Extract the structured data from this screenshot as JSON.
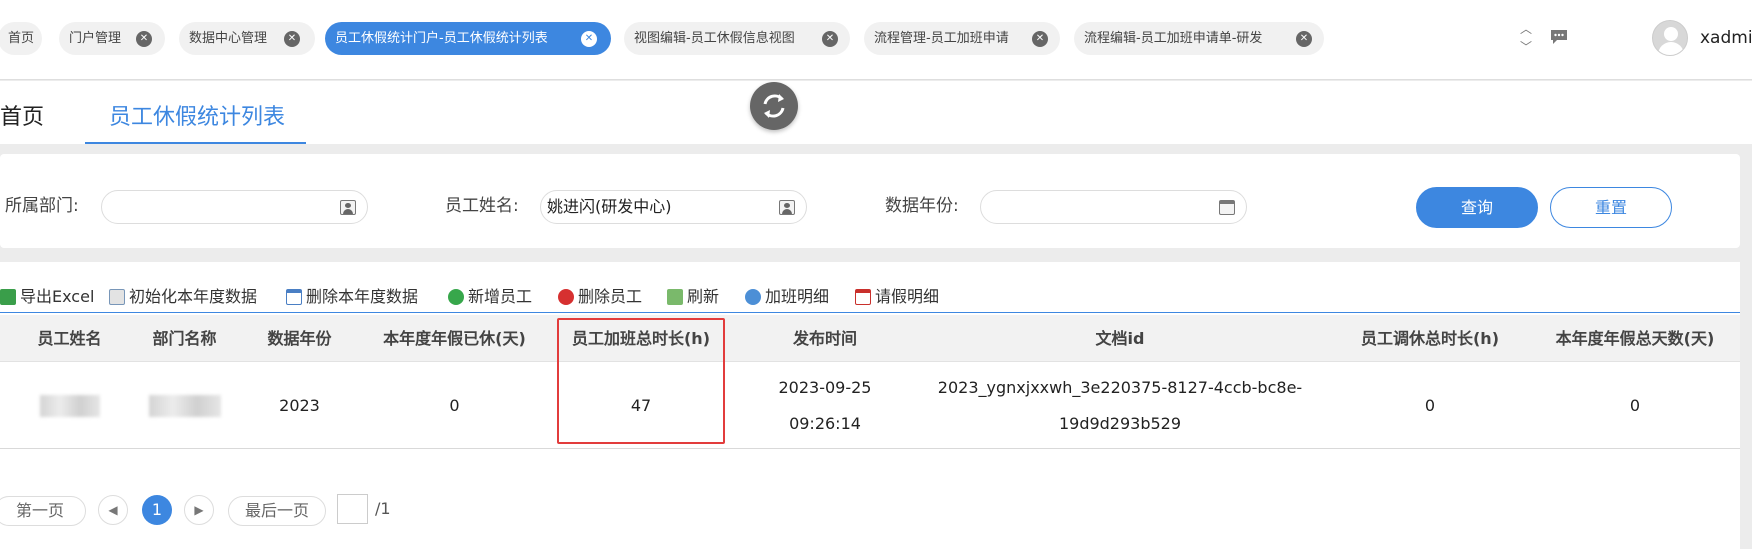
{
  "top_tabs": [
    {
      "label": "首页",
      "closable": false
    },
    {
      "label": "门户管理",
      "closable": true
    },
    {
      "label": "数据中心管理",
      "closable": true
    },
    {
      "label": "员工休假统计门户-员工休假统计列表",
      "closable": true,
      "active": true
    },
    {
      "label": "视图编辑-员工休假信息视图",
      "closable": true
    },
    {
      "label": "流程管理-员工加班申请",
      "closable": true
    },
    {
      "label": "流程编辑-员工加班申请单-研发",
      "closable": true
    }
  ],
  "user": {
    "name": "xadmin"
  },
  "page_tabs": [
    {
      "label": "首页"
    },
    {
      "label": "员工休假统计列表",
      "active": true
    }
  ],
  "filter": {
    "dept_label": "所属部门:",
    "dept_value": "",
    "name_label": "员工姓名:",
    "name_value": "姚进闪(研发中心)",
    "year_label": "数据年份:",
    "year_value": "",
    "search_btn": "查询",
    "reset_btn": "重置"
  },
  "toolbar": {
    "export": "导出Excel",
    "init": "初始化本年度数据",
    "delete_year": "删除本年度数据",
    "add_emp": "新增员工",
    "del_emp": "删除员工",
    "refresh": "刷新",
    "overtime": "加班明细",
    "leave": "请假明细"
  },
  "table": {
    "columns": [
      "员工姓名",
      "部门名称",
      "数据年份",
      "本年度年假已休(天)",
      "员工加班总时长(h)",
      "发布时间",
      "文档id",
      "员工调休总时长(h)",
      "本年度年假总天数(天)"
    ],
    "rows": [
      {
        "year": "2023",
        "annual_used": "0",
        "overtime_total": "47",
        "publish_date": "2023-09-25",
        "publish_time": "09:26:14",
        "doc_id_1": "2023_ygnxjxxwh_3e220375-8127-4ccb-bc8e-",
        "doc_id_2": "19d9d293b529",
        "comp_total": "0",
        "annual_total": "0"
      }
    ]
  },
  "pager": {
    "first": "第一页",
    "current": "1",
    "last": "最后一页",
    "total": "/1"
  },
  "colors": {
    "accent": "#3d87e0",
    "highlight": "#e23c3c"
  }
}
